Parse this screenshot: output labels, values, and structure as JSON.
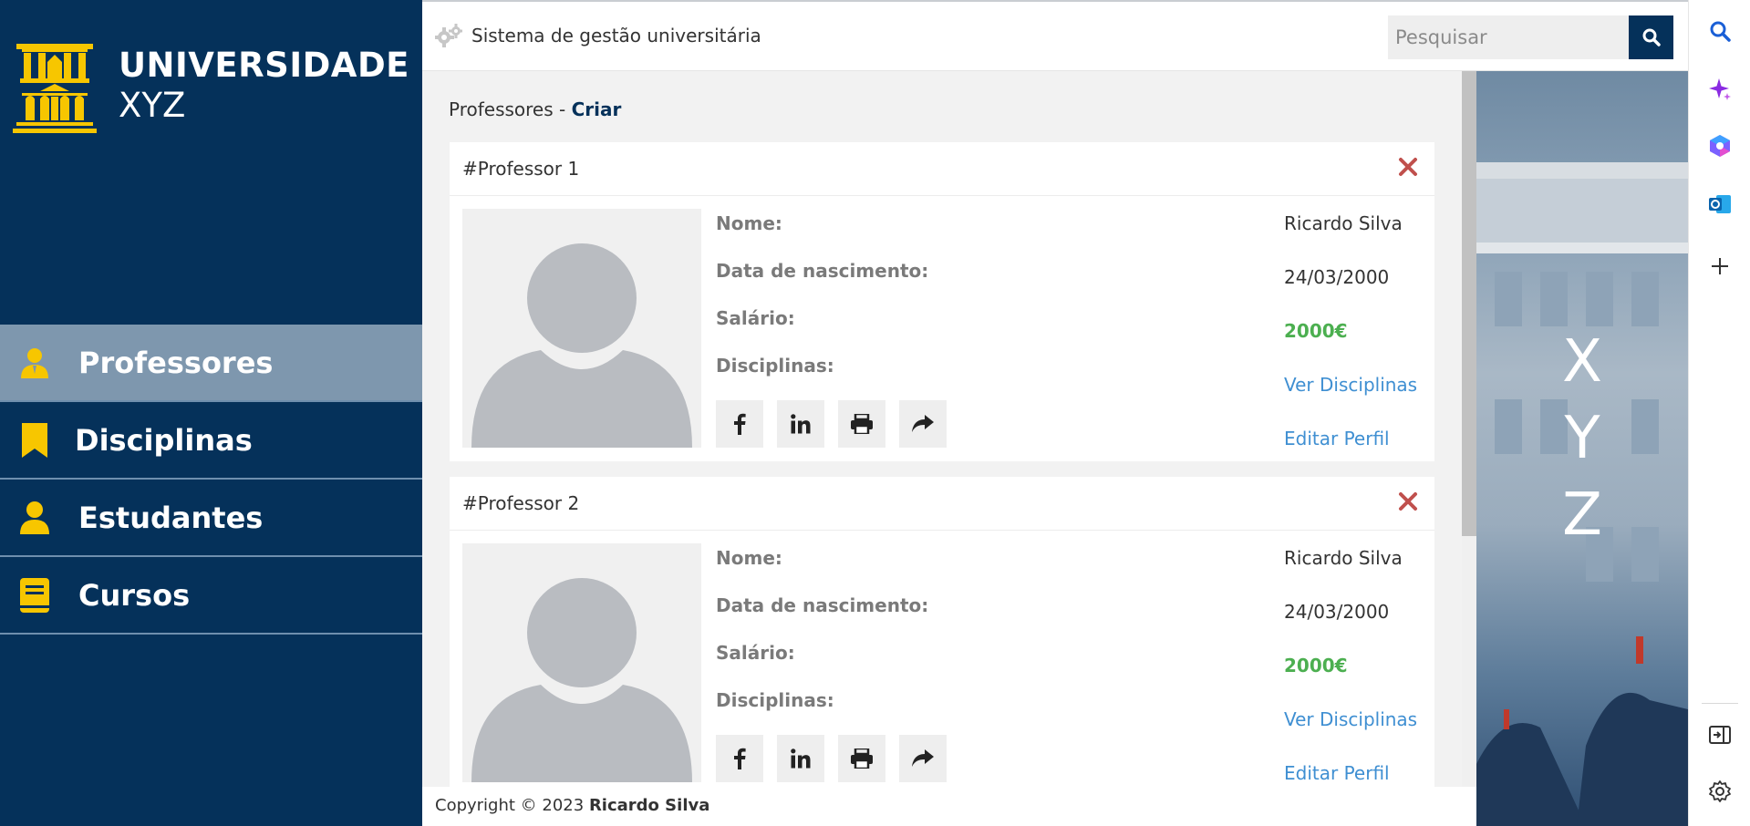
{
  "brand": {
    "line1": "UNIVERSIDADE",
    "line2": "XYZ"
  },
  "nav": [
    {
      "label": "Professores",
      "icon": "teacher-icon"
    },
    {
      "label": "Disciplinas",
      "icon": "bookmark-icon"
    },
    {
      "label": "Estudantes",
      "icon": "user-icon"
    },
    {
      "label": "Cursos",
      "icon": "book-icon"
    }
  ],
  "header": {
    "title": "Sistema de gestão universitária",
    "search_placeholder": "Pesquisar"
  },
  "breadcrumb": {
    "section": "Professores",
    "separator": " - ",
    "current": "Criar"
  },
  "professors": [
    {
      "title": "#Professor 1",
      "labels": {
        "name": "Nome:",
        "birth": "Data de nascimento:",
        "salary": "Salário:",
        "subjects": "Disciplinas:"
      },
      "name": "Ricardo Silva",
      "birth": "24/03/2000",
      "salary": "2000€",
      "subjects_link": "Ver Disciplinas",
      "edit_link": "Editar Perfil"
    },
    {
      "title": "#Professor 2",
      "labels": {
        "name": "Nome:",
        "birth": "Data de nascimento:",
        "salary": "Salário:",
        "subjects": "Disciplinas:"
      },
      "name": "Ricardo Silva",
      "birth": "24/03/2000",
      "salary": "2000€",
      "subjects_link": "Ver Disciplinas",
      "edit_link": "Editar Perfil"
    }
  ],
  "photo": {
    "letters": [
      "X",
      "Y",
      "Z"
    ]
  },
  "footer": {
    "prefix": "Copyright © 2023 ",
    "author": "Ricardo Silva"
  },
  "colors": {
    "primary": "#05315a",
    "accent": "#f7c600",
    "money": "#4caf50",
    "link": "#3f8fd2",
    "close": "#c0504d"
  }
}
